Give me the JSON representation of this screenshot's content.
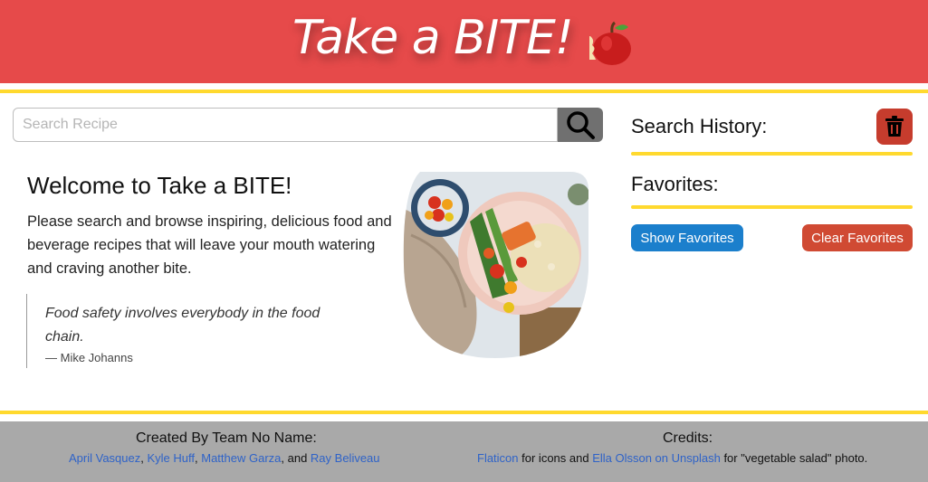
{
  "header": {
    "title": "Take a BITE!",
    "icon": "apple-icon"
  },
  "search": {
    "placeholder": "Search Recipe",
    "value": "",
    "button_icon": "search-icon"
  },
  "welcome": {
    "title": "Welcome to Take a BITE!",
    "text": "Please search and browse inspiring, delicious food and beverage recipes that will leave your mouth watering and craving another bite.",
    "quote": "Food safety involves everybody in the food chain.",
    "quote_author": "— Mike Johanns"
  },
  "sidebar": {
    "history_title": "Search History:",
    "trash_icon": "trash-icon",
    "favorites_title": "Favorites:",
    "show_favorites": "Show Favorites",
    "clear_favorites": "Clear Favorites"
  },
  "footer": {
    "team_title": "Created By Team No Name:",
    "members": [
      "April Vasquez",
      "Kyle Huff",
      "Matthew Garza",
      "Ray Beliveau"
    ],
    "sep1": ", ",
    "sep2": ", ",
    "sep3": ", and ",
    "credits_title": "Credits:",
    "credit_link1": "Flaticon",
    "credit_text1": " for icons and ",
    "credit_link2": "Ella Olsson on Unsplash",
    "credit_text2": " for \"vegetable salad\" photo."
  },
  "colors": {
    "header_bg": "#e64a4a",
    "accent_gold": "#ffd92e",
    "show_btn": "#1b7fcc",
    "clear_btn": "#d04a33",
    "trash_btn": "#c63c2d",
    "footer_bg": "#a9a9a9",
    "link": "#2f63c8"
  }
}
